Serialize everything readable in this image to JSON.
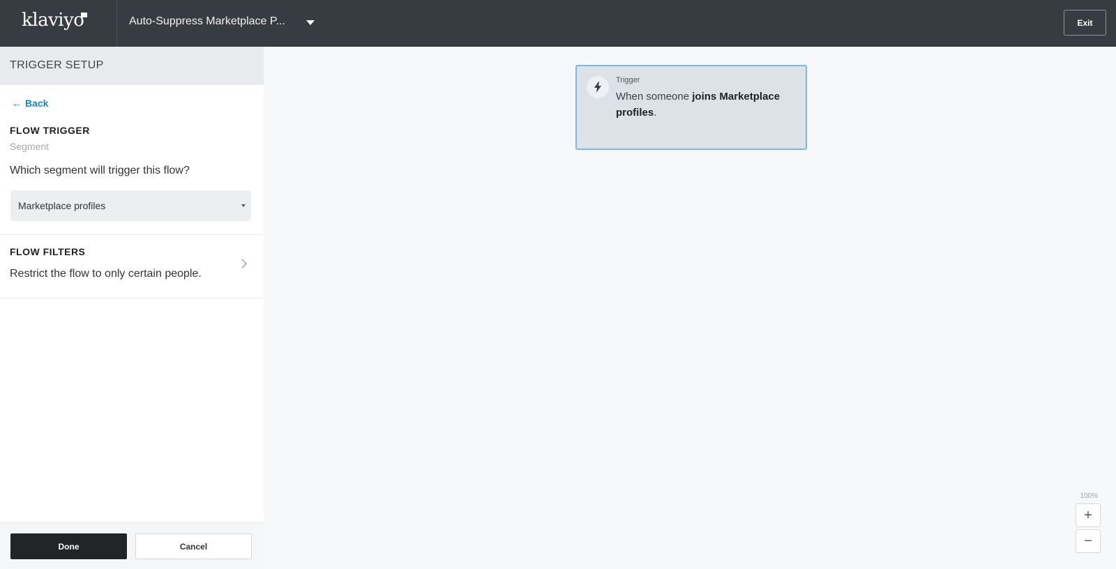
{
  "header": {
    "logo_text": "klaviyo",
    "flow_title": "Auto-Suppress Marketplace P...",
    "exit_label": "Exit"
  },
  "sidebar": {
    "header_title": "TRIGGER SETUP",
    "back_label": "Back",
    "flow_trigger": {
      "label": "FLOW TRIGGER",
      "type": "Segment",
      "question": "Which segment will trigger this flow?",
      "selected_segment": "Marketplace profiles"
    },
    "flow_filters": {
      "label": "FLOW FILTERS",
      "description": "Restrict the flow to only certain people."
    },
    "footer": {
      "done_label": "Done",
      "cancel_label": "Cancel"
    }
  },
  "canvas": {
    "trigger_card": {
      "kicker": "Trigger",
      "text_prefix": "When someone ",
      "text_bold": "joins Marketplace profiles",
      "text_suffix": "."
    },
    "zoom": {
      "level": "100%",
      "zoom_in_label": "+",
      "zoom_out_label": "−"
    }
  },
  "colors": {
    "topbar_bg": "#373c43",
    "accent_link": "#1a86c6",
    "card_border": "#7fb6e6",
    "done_bg": "#222426"
  },
  "icons": {
    "back": "arrow-left-icon",
    "dropdown": "caret-down-icon",
    "filters_chevron": "chevron-right-icon",
    "trigger": "lightning-bolt-icon"
  }
}
